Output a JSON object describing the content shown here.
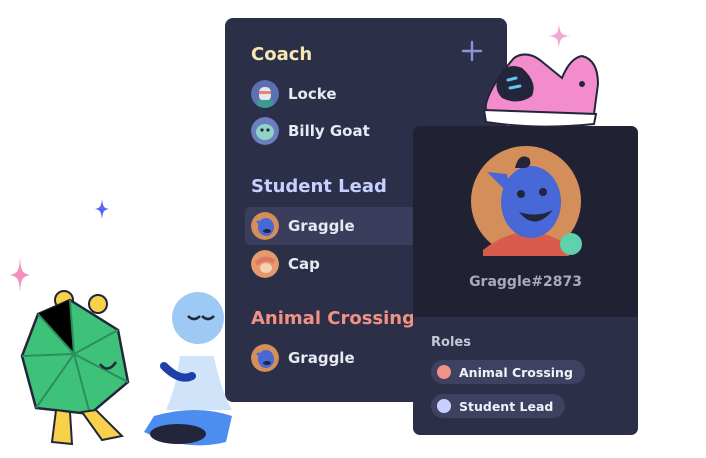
{
  "colors": {
    "coach": "#f7e7b0",
    "student_lead": "#c8d0ff",
    "animal_crossing": "#f19384",
    "panel": "#2c2f48",
    "online": "#5ed1ad"
  },
  "member_list": {
    "categories": [
      {
        "title": "Coach",
        "members": [
          {
            "name": "Locke",
            "avatar": "locke-avatar"
          },
          {
            "name": "Billy Goat",
            "avatar": "billy-goat-avatar"
          }
        ]
      },
      {
        "title": "Student Lead",
        "members": [
          {
            "name": "Graggle",
            "avatar": "graggle-avatar",
            "selected": true
          },
          {
            "name": "Cap",
            "avatar": "cap-avatar"
          }
        ]
      },
      {
        "title": "Animal Crossing",
        "members": [
          {
            "name": "Graggle",
            "avatar": "graggle-avatar"
          }
        ]
      }
    ]
  },
  "profile": {
    "tag": "Graggle#2873",
    "status": "online",
    "roles_heading": "Roles",
    "roles": [
      {
        "name": "Animal Crossing",
        "color": "#f19384"
      },
      {
        "name": "Student Lead",
        "color": "#c8d0ff"
      }
    ]
  }
}
